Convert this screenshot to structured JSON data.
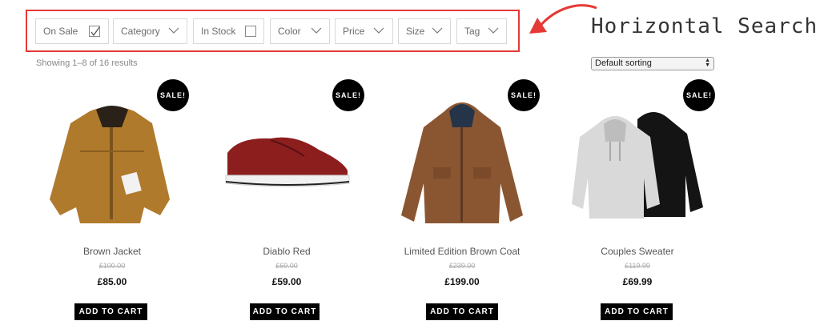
{
  "filters": {
    "on_sale": {
      "label": "On Sale",
      "checked": true
    },
    "category": {
      "label": "Category"
    },
    "in_stock": {
      "label": "In Stock",
      "checked": false
    },
    "color": {
      "label": "Color"
    },
    "price": {
      "label": "Price"
    },
    "size": {
      "label": "Size"
    },
    "tag": {
      "label": "Tag"
    }
  },
  "annotation": {
    "text": "Horizontal Search",
    "arrow_color": "#e53935"
  },
  "results": {
    "count_text": "Showing 1–8 of 16 results"
  },
  "sorting": {
    "selected": "Default sorting"
  },
  "products": [
    {
      "name": "Brown Jacket",
      "old_price": "£100.00",
      "price": "£85.00",
      "badge": "SALE!",
      "button": "ADD TO CART",
      "image": "brown-jacket"
    },
    {
      "name": "Diablo Red",
      "old_price": "£69.00",
      "price": "£59.00",
      "badge": "SALE!",
      "button": "ADD TO CART",
      "image": "red-sneaker"
    },
    {
      "name": "Limited Edition Brown Coat",
      "old_price": "£239.00",
      "price": "£199.00",
      "badge": "SALE!",
      "button": "ADD TO CART",
      "image": "brown-coat"
    },
    {
      "name": "Couples Sweater",
      "old_price": "£119.99",
      "price": "£69.99",
      "badge": "SALE!",
      "button": "ADD TO CART",
      "image": "hoodies"
    }
  ],
  "colors": {
    "frame": "#e53935",
    "badge": "#000000",
    "button": "#000000"
  }
}
